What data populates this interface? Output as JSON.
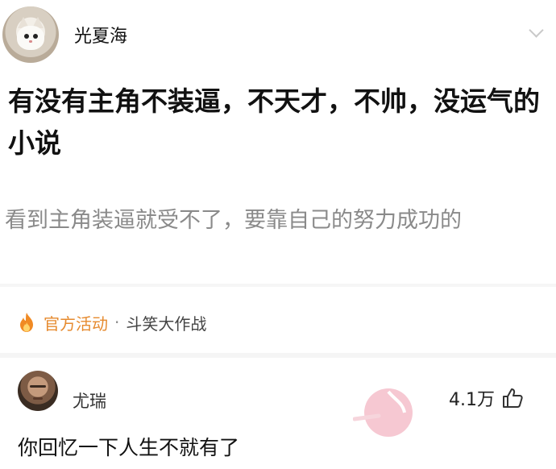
{
  "post": {
    "username": "光夏海",
    "title": "有没有主角不装逼，不天才，不帅，没运气的小说",
    "description": "看到主角装逼就受不了，要靠自己的努力成功的"
  },
  "activity": {
    "label": "官方活动",
    "separator": "·",
    "name": "斗笑大作战"
  },
  "comment": {
    "username": "尤瑞",
    "like_count": "4.1万",
    "text": "你回忆一下人生不就有了"
  },
  "colors": {
    "activity_accent": "#e68a2e",
    "watermark": "#f0a0b0"
  },
  "icons": {
    "expand": "chevron-down-icon",
    "activity": "fire-icon",
    "like": "thumbs-up-icon"
  }
}
